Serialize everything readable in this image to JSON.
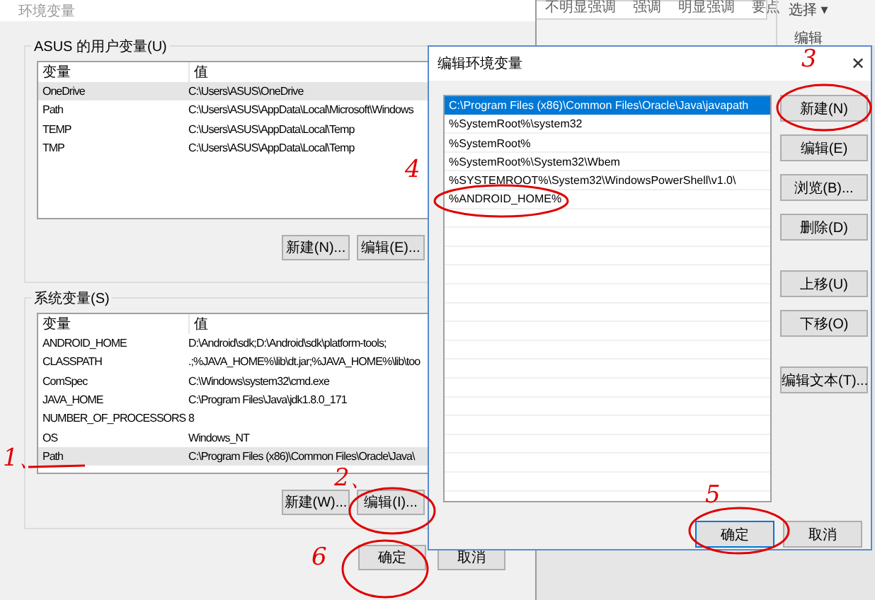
{
  "background_ribbon": {
    "styles": [
      "不明显强调",
      "强调",
      "明显强调",
      "要点"
    ],
    "select": "选择 ▾",
    "group_label": "编辑"
  },
  "env_window": {
    "title": "环境变量",
    "user_vars": {
      "legend": "ASUS 的用户变量(U)",
      "columns": [
        "变量",
        "值"
      ],
      "rows": [
        {
          "variable": "OneDrive",
          "value": "C:\\Users\\ASUS\\OneDrive",
          "selected": true
        },
        {
          "variable": "Path",
          "value": "C:\\Users\\ASUS\\AppData\\Local\\Microsoft\\Windows",
          "selected": false
        },
        {
          "variable": "TEMP",
          "value": "C:\\Users\\ASUS\\AppData\\Local\\Temp",
          "selected": false
        },
        {
          "variable": "TMP",
          "value": "C:\\Users\\ASUS\\AppData\\Local\\Temp",
          "selected": false
        }
      ],
      "buttons": [
        "新建(N)...",
        "编辑(E)..."
      ]
    },
    "system_vars": {
      "legend": "系统变量(S)",
      "columns": [
        "变量",
        "值"
      ],
      "rows": [
        {
          "variable": "ANDROID_HOME",
          "value": "D:\\Android\\sdk;D:\\Android\\sdk\\platform-tools;",
          "selected": false
        },
        {
          "variable": "CLASSPATH",
          "value": ".;%JAVA_HOME%\\lib\\dt.jar;%JAVA_HOME%\\lib\\too",
          "selected": false
        },
        {
          "variable": "ComSpec",
          "value": "C:\\Windows\\system32\\cmd.exe",
          "selected": false
        },
        {
          "variable": "JAVA_HOME",
          "value": "C:\\Program Files\\Java\\jdk1.8.0_171",
          "selected": false
        },
        {
          "variable": "NUMBER_OF_PROCESSORS",
          "value": "8",
          "selected": false
        },
        {
          "variable": "OS",
          "value": "Windows_NT",
          "selected": false
        },
        {
          "variable": "Path",
          "value": "C:\\Program Files (x86)\\Common Files\\Oracle\\Java\\",
          "selected": true
        }
      ],
      "buttons": [
        "新建(W)...",
        "编辑(I)..."
      ]
    },
    "footer_buttons": [
      "确定",
      "取消"
    ]
  },
  "edit_dialog": {
    "title": "编辑环境变量",
    "close": "✕",
    "entries": [
      {
        "text": "C:\\Program Files (x86)\\Common Files\\Oracle\\Java\\javapath",
        "selected": true
      },
      {
        "text": "%SystemRoot%\\system32",
        "selected": false
      },
      {
        "text": "%SystemRoot%",
        "selected": false
      },
      {
        "text": "%SystemRoot%\\System32\\Wbem",
        "selected": false
      },
      {
        "text": "%SYSTEMROOT%\\System32\\WindowsPowerShell\\v1.0\\",
        "selected": false
      },
      {
        "text": "%ANDROID_HOME%",
        "selected": false
      }
    ],
    "side_buttons": [
      [
        "新建(N)",
        "编辑(E)",
        "浏览(B)...",
        "删除(D)"
      ],
      [
        "上移(U)",
        "下移(O)"
      ],
      [
        "编辑文本(T)..."
      ]
    ],
    "footer_buttons": [
      {
        "label": "确定",
        "default": true
      },
      {
        "label": "取消",
        "default": false
      }
    ]
  },
  "annotations": [
    "1、",
    "2、",
    "3",
    "4",
    "5",
    "6"
  ]
}
